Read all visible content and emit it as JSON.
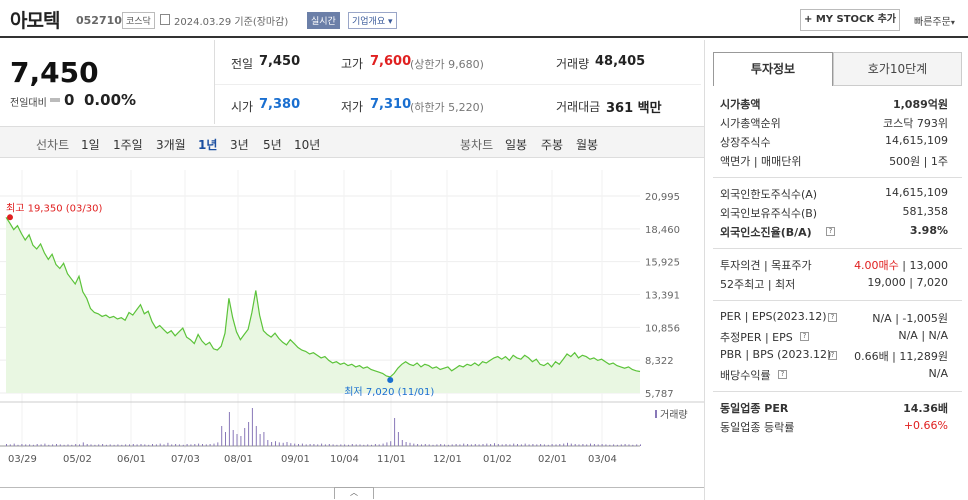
{
  "header": {
    "name": "아모텍",
    "code": "052710",
    "market": "코스닥",
    "date": "2024.03.29  기준(장마감)",
    "realtime": "실시간",
    "overview": "기업개요",
    "mystock": "+ MY STOCK 추가",
    "quick_order": "빠른주문"
  },
  "price": {
    "current": "7,450",
    "change_label": "전일대비",
    "change_value": "0",
    "change_rate": "0.00%"
  },
  "quote": {
    "prev_label": "전일",
    "prev": "7,450",
    "high_label": "고가",
    "high": "7,600",
    "upper_limit": "(상한가 9,680)",
    "volume_label": "거래량",
    "volume": "48,405",
    "open_label": "시가",
    "open": "7,380",
    "low_label": "저가",
    "low": "7,310",
    "lower_limit": "(하한가 5,220)",
    "amount_label": "거래대금",
    "amount": "361 백만"
  },
  "period": {
    "line_label": "선차트",
    "line_items": [
      "1일",
      "1주일",
      "3개월",
      "1년",
      "3년",
      "5년",
      "10년"
    ],
    "candle_label": "봉차트",
    "candle_items": [
      "일봉",
      "주봉",
      "월봉"
    ]
  },
  "chart_data": {
    "type": "area",
    "y_ticks": [
      "20,995",
      "18,460",
      "15,925",
      "13,391",
      "10,856",
      "8,322",
      "5,787"
    ],
    "ylim": [
      5787,
      20995
    ],
    "x_ticks": [
      "03/29",
      "05/02",
      "06/01",
      "07/03",
      "08/01",
      "09/01",
      "10/04",
      "11/01",
      "12/01",
      "01/02",
      "02/01",
      "03/04"
    ],
    "max_label": "최고 19,350 (03/30)",
    "min_label": "최저 7,020 (11/01)",
    "volume_legend": "거래량",
    "series": [
      {
        "values": [
          19350,
          18900,
          18400,
          18700,
          18100,
          17600,
          18000,
          17200,
          16900,
          17300,
          16600,
          16100,
          16500,
          15700,
          15400,
          15800,
          15000,
          14600,
          14200,
          14800,
          13600,
          13100,
          12300,
          12000,
          11900,
          11700,
          11800,
          11600,
          11700,
          11500,
          11600,
          11400,
          12000,
          11800,
          12200,
          12600,
          11900,
          12100,
          11300,
          10800,
          11000,
          10700,
          10400,
          10600,
          10200,
          10500,
          10800,
          10100,
          9900,
          9600,
          10300,
          9800,
          9500,
          9700,
          9200,
          9100,
          9400,
          10400,
          13100,
          11600,
          10500,
          9900,
          10300,
          10700,
          12000,
          13700,
          11800,
          10600,
          10300,
          10100,
          10400,
          10000,
          9700,
          9500,
          9900,
          9600,
          9300,
          9100,
          9000,
          8800,
          8900,
          8700,
          8500,
          8600,
          8300,
          8100,
          8200,
          8000,
          8100,
          7900,
          8000,
          7800,
          7900,
          7700,
          7800,
          7600,
          7500,
          7400,
          7300,
          7100,
          7020,
          7300,
          7700,
          8000,
          8200,
          8000,
          7900,
          8100,
          7800,
          8000,
          7900,
          7700,
          7800,
          7600,
          7700,
          7800,
          7500,
          7700,
          7900,
          7800,
          8000,
          7900,
          8100,
          7900,
          8200,
          8100,
          8300,
          8500,
          8600,
          8400,
          8600,
          8300,
          8700,
          8500,
          8400,
          8700,
          8500,
          8200,
          8400,
          8000,
          7900,
          8100,
          7800,
          8200,
          8000,
          8400,
          8800,
          8600,
          8900,
          8500,
          8700,
          8600,
          8400,
          8500,
          8300,
          8400,
          8200,
          8000,
          8100,
          7900,
          7800,
          7700,
          7800,
          7600,
          7500,
          7450
        ]
      }
    ],
    "volume": [
      0.05,
      0.04,
      0.06,
      0.03,
      0.05,
      0.04,
      0.04,
      0.03,
      0.05,
      0.04,
      0.06,
      0.03,
      0.04,
      0.05,
      0.04,
      0.03,
      0.04,
      0.03,
      0.05,
      0.04,
      0.09,
      0.05,
      0.04,
      0.03,
      0.04,
      0.05,
      0.03,
      0.04,
      0.03,
      0.04,
      0.03,
      0.04,
      0.04,
      0.05,
      0.04,
      0.05,
      0.04,
      0.03,
      0.05,
      0.04,
      0.06,
      0.04,
      0.08,
      0.04,
      0.05,
      0.04,
      0.03,
      0.05,
      0.04,
      0.05,
      0.06,
      0.05,
      0.04,
      0.05,
      0.06,
      0.09,
      0.5,
      0.35,
      0.85,
      0.4,
      0.3,
      0.25,
      0.45,
      0.6,
      0.95,
      0.5,
      0.3,
      0.35,
      0.15,
      0.1,
      0.12,
      0.09,
      0.08,
      0.1,
      0.07,
      0.06,
      0.05,
      0.06,
      0.04,
      0.05,
      0.05,
      0.04,
      0.06,
      0.04,
      0.05,
      0.04,
      0.03,
      0.04,
      0.04,
      0.03,
      0.05,
      0.04,
      0.04,
      0.03,
      0.04,
      0.03,
      0.05,
      0.04,
      0.06,
      0.09,
      0.12,
      0.7,
      0.35,
      0.15,
      0.1,
      0.08,
      0.06,
      0.05,
      0.04,
      0.05,
      0.04,
      0.03,
      0.04,
      0.05,
      0.04,
      0.03,
      0.04,
      0.05,
      0.04,
      0.06,
      0.05,
      0.04,
      0.05,
      0.04,
      0.05,
      0.06,
      0.05,
      0.07,
      0.05,
      0.04,
      0.05,
      0.04,
      0.06,
      0.05,
      0.04,
      0.06,
      0.04,
      0.05,
      0.04,
      0.05,
      0.04,
      0.03,
      0.05,
      0.04,
      0.05,
      0.06,
      0.08,
      0.06,
      0.05,
      0.04,
      0.05,
      0.04,
      0.06,
      0.05,
      0.04,
      0.05,
      0.04,
      0.03,
      0.04,
      0.03,
      0.04,
      0.05,
      0.04,
      0.03,
      0.04,
      0.04
    ]
  },
  "tabs": {
    "invest": "투자정보",
    "hoga": "호가10단계"
  },
  "invest": {
    "mktcap_label": "시가총액",
    "mktcap": "1,089억원",
    "rank_label": "시가총액순위",
    "rank": "코스닥 793위",
    "shares_label": "상장주식수",
    "shares": "14,615,109",
    "par_label": "액면가 | 매매단위",
    "par": "500원 | 1주",
    "foreign_limit_label": "외국인한도주식수(A)",
    "foreign_limit": "14,615,109",
    "foreign_hold_label": "외국인보유주식수(B)",
    "foreign_hold": "581,358",
    "foreign_rate_label": "외국인소진율(B/A)",
    "foreign_rate": "3.98%",
    "opinion_label": "투자의견 | 목표주가",
    "opinion": "4.00매수",
    "target": "| 13,000",
    "w52_label": "52주최고 | 최저",
    "w52": "19,000 | 7,020",
    "per_label": "PER | EPS(2023.12)",
    "per": "N/A | -1,005원",
    "eper_label": "추정PER | EPS",
    "eper": "N/A | N/A",
    "pbr_label": "PBR | BPS (2023.12)",
    "pbr": "0.66배 | 11,289원",
    "div_label": "배당수익률",
    "div": "N/A",
    "ind_per_label": "동일업종 PER",
    "ind_per": "14.36배",
    "ind_rate_label": "동일업종 등락률",
    "ind_rate": "+0.66%"
  },
  "colors": {
    "up": "#e02020",
    "down": "#1a6fd0",
    "line": "#5cc33a",
    "area": "#e9f7e2"
  }
}
